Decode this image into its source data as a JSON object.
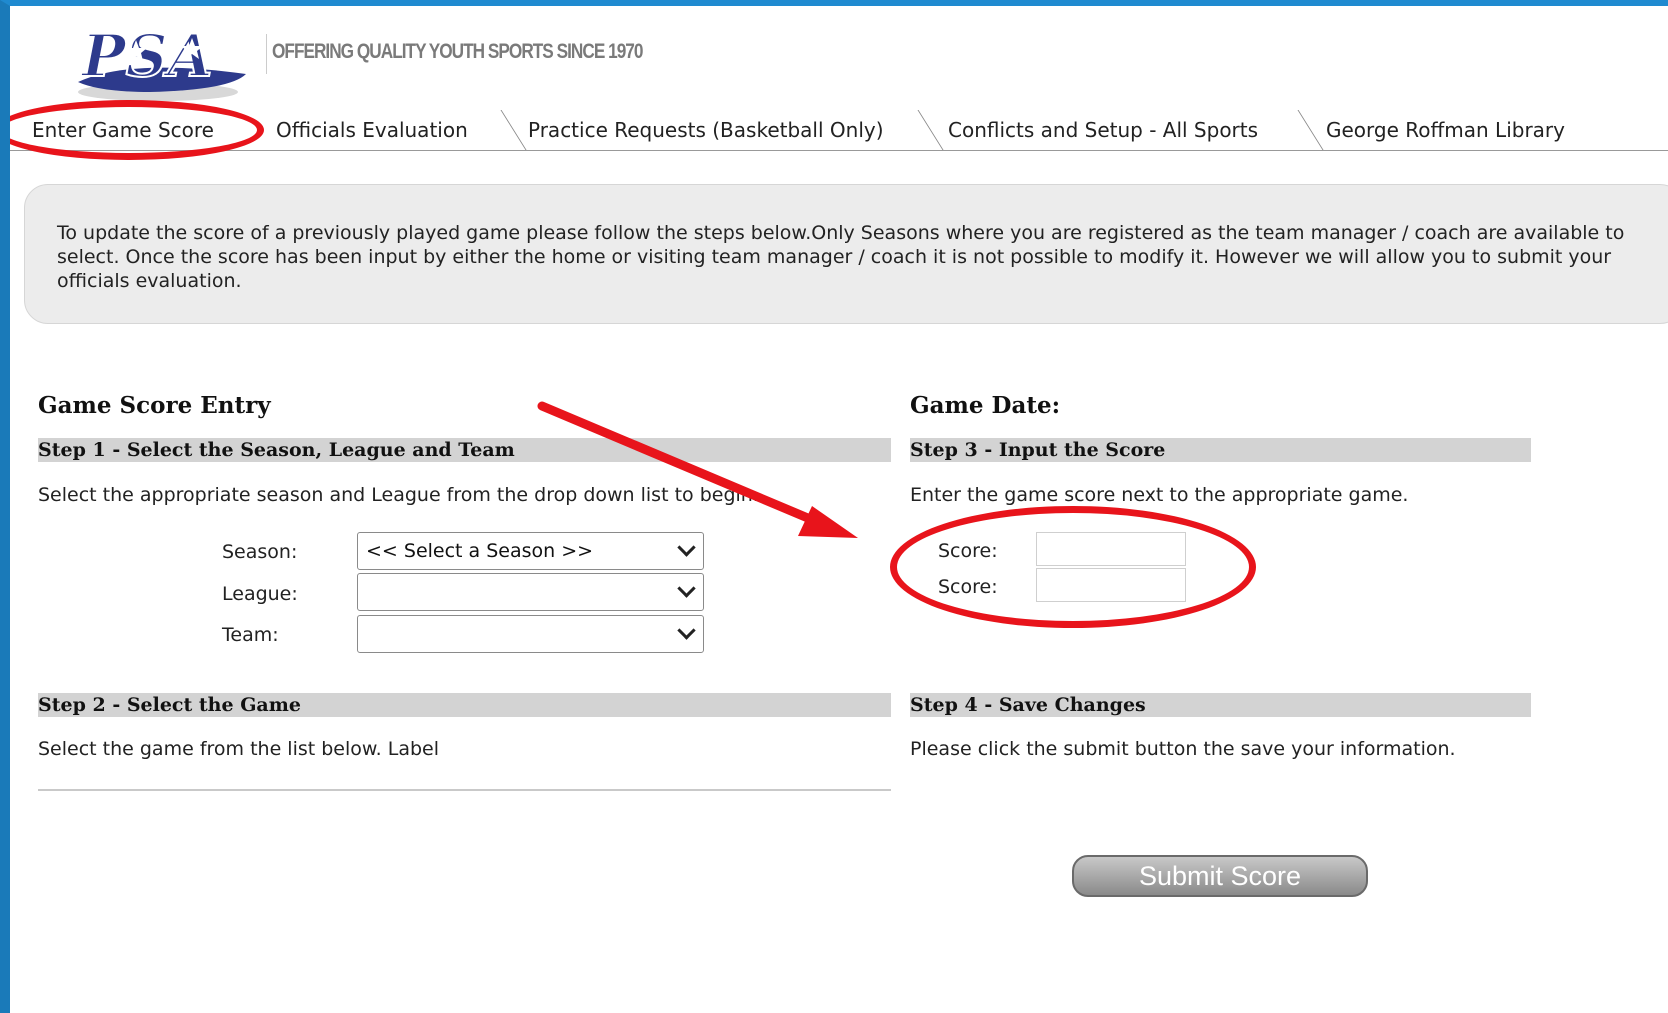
{
  "brand": {
    "logo_text": "PSA",
    "tagline": "OFFERING QUALITY YOUTH SPORTS SINCE 1970"
  },
  "tabs": [
    {
      "label": "Enter Game Score",
      "active": true
    },
    {
      "label": "Officials Evaluation",
      "active": false
    },
    {
      "label": "Practice Requests (Basketball Only)",
      "active": false
    },
    {
      "label": "Conflicts and Setup - All Sports",
      "active": false
    },
    {
      "label": "George Roffman Library",
      "active": false
    }
  ],
  "notice": {
    "text": "To update the score of a previously played game please follow the steps below.Only Seasons where you are registered as the team manager / coach are available to select.  Once the score has been input by either the home or visiting team manager / coach it is not possible to modify it. However we will allow you to submit your officials evaluation."
  },
  "left": {
    "heading": "Game Score Entry",
    "step1": {
      "title": "Step 1 - Select the Season, League and Team",
      "instruction": "Select the appropriate season and League from the drop down list to begin.",
      "season_label": "Season:",
      "season_value": "<< Select a Season >>",
      "league_label": "League:",
      "league_value": "",
      "team_label": "Team:",
      "team_value": ""
    },
    "step2": {
      "title": "Step 2 - Select the Game",
      "instruction": "Select the game from the list below. Label"
    }
  },
  "right": {
    "heading": "Game Date:",
    "step3": {
      "title": "Step 3 - Input the Score",
      "instruction": "Enter the game score next to the appropriate game.",
      "score1_label": "Score:",
      "score1_value": "",
      "score2_label": "Score:",
      "score2_value": ""
    },
    "step4": {
      "title": "Step 4 - Save Changes",
      "instruction": "Please click the submit button the save your information."
    },
    "submit_label": "Submit Score"
  },
  "annotations": {
    "color": "#e8141b"
  }
}
